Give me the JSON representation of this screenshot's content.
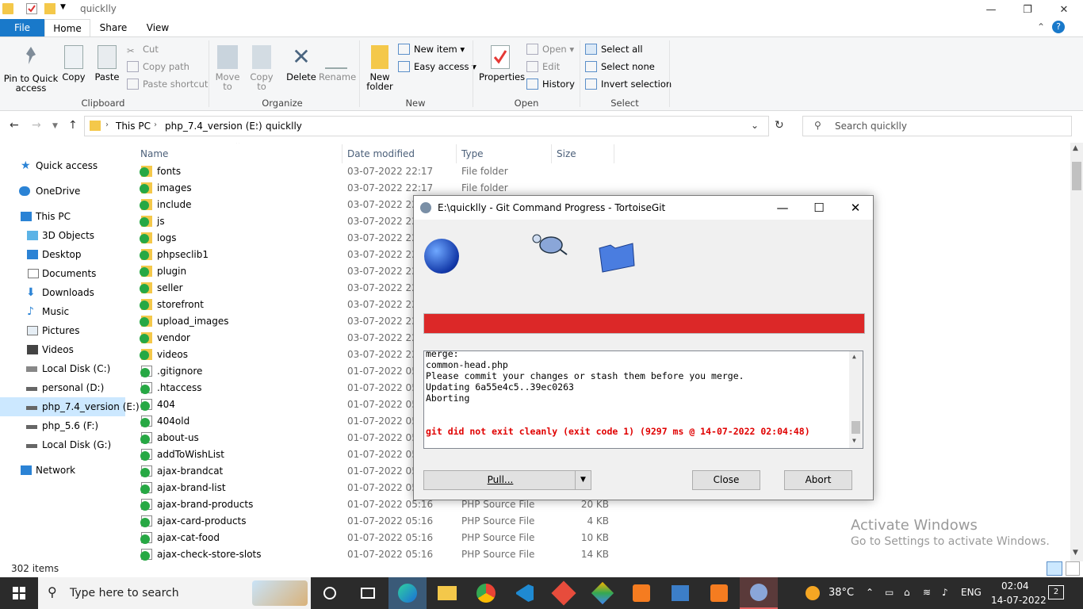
{
  "window": {
    "title": "quicklly"
  },
  "ribbon_tabs": [
    "File",
    "Home",
    "Share",
    "View"
  ],
  "clipboard": {
    "pin": "Pin to Quick access",
    "copy": "Copy",
    "paste": "Paste",
    "cut": "Cut",
    "copy_path": "Copy path",
    "paste_shortcut": "Paste shortcut",
    "label": "Clipboard"
  },
  "organize": {
    "move_to": "Move to",
    "copy_to": "Copy to",
    "delete": "Delete",
    "rename": "Rename",
    "label": "Organize"
  },
  "new": {
    "new_folder": "New folder",
    "new_item": "New item",
    "easy_access": "Easy access",
    "label": "New"
  },
  "open": {
    "properties": "Properties",
    "open": "Open",
    "edit": "Edit",
    "history": "History",
    "label": "Open"
  },
  "select": {
    "select_all": "Select all",
    "select_none": "Select none",
    "invert": "Invert selection",
    "label": "Select"
  },
  "breadcrumb": [
    "This PC",
    "php_7.4_version (E:)",
    "quicklly"
  ],
  "search": {
    "placeholder": "Search quicklly"
  },
  "nav_items": [
    "Quick access",
    "OneDrive",
    "This PC",
    "3D Objects",
    "Desktop",
    "Documents",
    "Downloads",
    "Music",
    "Pictures",
    "Videos",
    "Local Disk (C:)",
    "personal (D:)",
    "php_7.4_version (E:)",
    "php_5.6 (F:)",
    "Local Disk (G:)",
    "Network"
  ],
  "columns": {
    "name": "Name",
    "date": "Date modified",
    "type": "Type",
    "size": "Size"
  },
  "files": [
    {
      "name": "fonts",
      "date": "03-07-2022 22:17",
      "type": "File folder",
      "size": "",
      "kind": "folder"
    },
    {
      "name": "images",
      "date": "03-07-2022 22:17",
      "type": "File folder",
      "size": "",
      "kind": "folder"
    },
    {
      "name": "include",
      "date": "03-07-2022 22:1",
      "type": "",
      "size": "",
      "kind": "folder"
    },
    {
      "name": "js",
      "date": "03-07-2022 22:1",
      "type": "",
      "size": "",
      "kind": "folder"
    },
    {
      "name": "logs",
      "date": "03-07-2022 22:1",
      "type": "",
      "size": "",
      "kind": "folder"
    },
    {
      "name": "phpseclib1",
      "date": "03-07-2022 22:1",
      "type": "",
      "size": "",
      "kind": "folder"
    },
    {
      "name": "plugin",
      "date": "03-07-2022 22:1",
      "type": "",
      "size": "",
      "kind": "folder"
    },
    {
      "name": "seller",
      "date": "03-07-2022 22:2",
      "type": "",
      "size": "",
      "kind": "folder"
    },
    {
      "name": "storefront",
      "date": "03-07-2022 22:2",
      "type": "",
      "size": "",
      "kind": "folder"
    },
    {
      "name": "upload_images",
      "date": "03-07-2022 22:2",
      "type": "",
      "size": "",
      "kind": "folder"
    },
    {
      "name": "vendor",
      "date": "03-07-2022 22:2",
      "type": "",
      "size": "",
      "kind": "folder"
    },
    {
      "name": "videos",
      "date": "03-07-2022 22:2",
      "type": "",
      "size": "",
      "kind": "folder"
    },
    {
      "name": ".gitignore",
      "date": "01-07-2022 05:1",
      "type": "",
      "size": "",
      "kind": "file"
    },
    {
      "name": ".htaccess",
      "date": "01-07-2022 05:1",
      "type": "",
      "size": "",
      "kind": "file"
    },
    {
      "name": "404",
      "date": "01-07-2022 05:1",
      "type": "",
      "size": "",
      "kind": "php"
    },
    {
      "name": "404old",
      "date": "01-07-2022 05:1",
      "type": "",
      "size": "",
      "kind": "php"
    },
    {
      "name": "about-us",
      "date": "01-07-2022 05:1",
      "type": "",
      "size": "",
      "kind": "php"
    },
    {
      "name": "addToWishList",
      "date": "01-07-2022 05:1",
      "type": "",
      "size": "",
      "kind": "php"
    },
    {
      "name": "ajax-brandcat",
      "date": "01-07-2022 05:1",
      "type": "",
      "size": "",
      "kind": "php"
    },
    {
      "name": "ajax-brand-list",
      "date": "01-07-2022 05:1",
      "type": "",
      "size": "",
      "kind": "php"
    },
    {
      "name": "ajax-brand-products",
      "date": "01-07-2022 05:16",
      "type": "PHP Source File",
      "size": "20 KB",
      "kind": "php"
    },
    {
      "name": "ajax-card-products",
      "date": "01-07-2022 05:16",
      "type": "PHP Source File",
      "size": "4 KB",
      "kind": "php"
    },
    {
      "name": "ajax-cat-food",
      "date": "01-07-2022 05:16",
      "type": "PHP Source File",
      "size": "10 KB",
      "kind": "php"
    },
    {
      "name": "ajax-check-store-slots",
      "date": "01-07-2022 05:16",
      "type": "PHP Source File",
      "size": "14 KB",
      "kind": "php"
    }
  ],
  "status": {
    "count": "302 items"
  },
  "watermark": {
    "line1": "Activate Windows",
    "line2": "Go to Settings to activate Windows."
  },
  "dialog": {
    "title": "E:\\quicklly - Git Command Progress - TortoiseGit",
    "log": [
      "merge:",
      "common-head.php",
      "Please commit your changes or stash them before you merge.",
      "Updating 6a55e4c5..39ec0263",
      "Aborting"
    ],
    "error": "git did not exit cleanly (exit code 1) (9297 ms @ 14-07-2022 02:04:48)",
    "pull": "Pull...",
    "close": "Close",
    "abort": "Abort",
    "progress_color": "#dc2828"
  },
  "taskbar": {
    "search": "Type here to search",
    "temp": "38°C",
    "lang": "ENG",
    "time": "02:04",
    "date": "14-07-2022",
    "notif": "2"
  }
}
